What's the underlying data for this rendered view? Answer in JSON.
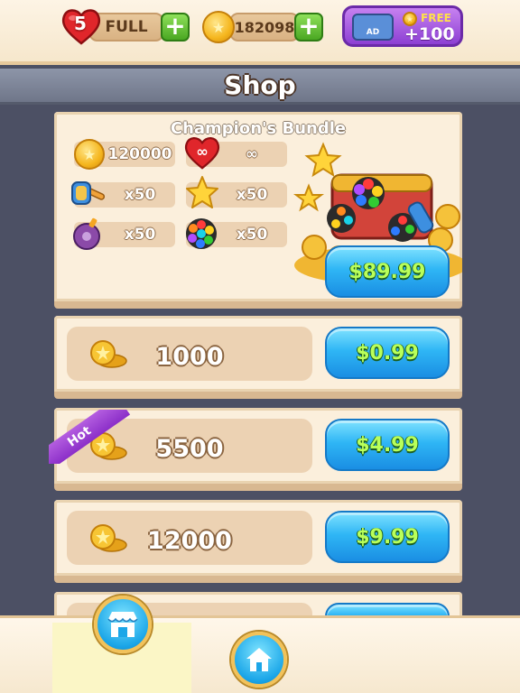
{
  "topbar": {
    "lives": {
      "count": "5",
      "status": "FULL"
    },
    "coins": {
      "amount": "182098"
    },
    "ad_reward": {
      "badge": "AD",
      "free_label": "FREE",
      "amount": "+100"
    }
  },
  "title": "Shop",
  "bundle": {
    "name": "Champion's Bundle",
    "items": [
      {
        "icon": "coin-icon",
        "value": "120000"
      },
      {
        "icon": "infinite-heart-icon",
        "value": "∞"
      },
      {
        "icon": "hammer-icon",
        "value": "x50"
      },
      {
        "icon": "star-icon",
        "value": "x50"
      },
      {
        "icon": "bomb-icon",
        "value": "x50"
      },
      {
        "icon": "rainbow-ball-icon",
        "value": "x50"
      }
    ],
    "price": "$89.99"
  },
  "offers": [
    {
      "amount": "1000",
      "price": "$0.99",
      "hot": false
    },
    {
      "amount": "5500",
      "price": "$4.99",
      "hot": true,
      "hot_label": "Hot"
    },
    {
      "amount": "12000",
      "price": "$9.99",
      "hot": false
    }
  ],
  "colors": {
    "background": "#4c5064",
    "card": "#fbefdc",
    "price_button": "#2fb6f5",
    "price_text": "#b9ff5a",
    "hot_ribbon": "#8b2ec8"
  },
  "bottom_nav": [
    "store-icon",
    "home-icon"
  ]
}
